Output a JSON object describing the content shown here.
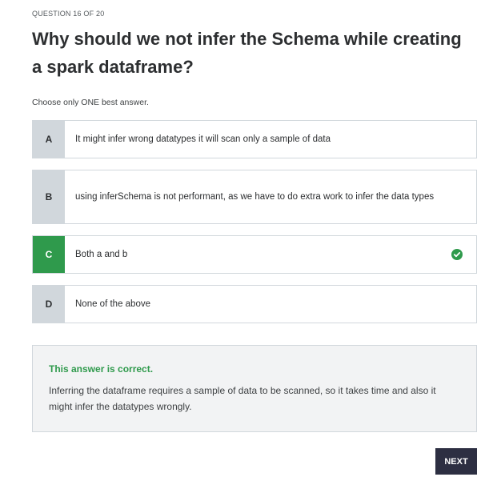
{
  "header": {
    "progress": "QUESTION 16 OF 20"
  },
  "question": {
    "text": "Why should we not infer the Schema while creating a spark dataframe?",
    "instruction": "Choose only ONE best answer."
  },
  "options": [
    {
      "letter": "A",
      "text": "It might infer wrong datatypes it will scan only a sample of data",
      "state": "default"
    },
    {
      "letter": "B",
      "text": "using inferSchema is not performant, as we have to do extra work to infer the data types",
      "state": "default"
    },
    {
      "letter": "C",
      "text": "Both a and b",
      "state": "correct",
      "icon": "check-circle-icon"
    },
    {
      "letter": "D",
      "text": "None of the above",
      "state": "default"
    }
  ],
  "feedback": {
    "title": "This answer is correct.",
    "body": "Inferring the dataframe requires a sample of data to be scanned, so it takes time and also it might infer the datatypes wrongly."
  },
  "actions": {
    "next_label": "NEXT"
  },
  "colors": {
    "correct_green": "#2f9a4c",
    "letter_bg": "#d1d7dc",
    "feedback_bg": "#f2f3f4",
    "next_bg": "#2d2f42",
    "text": "#2d2f31"
  }
}
